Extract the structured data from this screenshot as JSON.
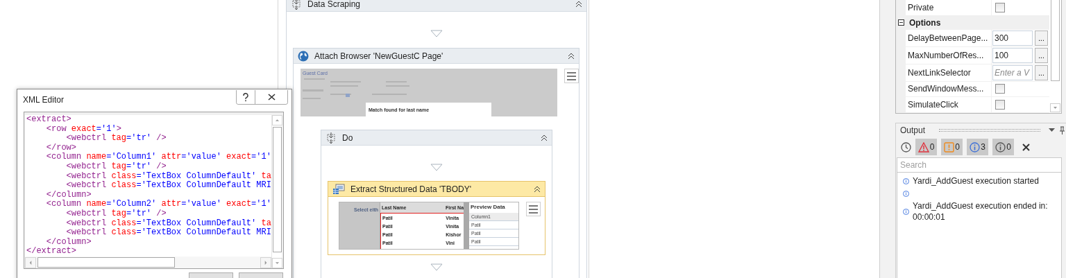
{
  "xml_editor": {
    "title": "XML Editor",
    "lines": [
      [
        {
          "kind": "tag",
          "text": "<extract>"
        }
      ],
      [
        {
          "kind": "tag",
          "text": "    <row"
        },
        {
          "kind": "attr",
          "text": " exact"
        },
        {
          "kind": "value",
          "text": "='1'"
        },
        {
          "kind": "tag",
          "text": ">"
        }
      ],
      [
        {
          "kind": "tag",
          "text": "        <webctrl"
        },
        {
          "kind": "attr",
          "text": " tag"
        },
        {
          "kind": "value",
          "text": "='tr'"
        },
        {
          "kind": "tag",
          "text": " />"
        }
      ],
      [
        {
          "kind": "tag",
          "text": "    </row>"
        }
      ],
      [
        {
          "kind": "tag",
          "text": "    <column"
        },
        {
          "kind": "attr",
          "text": " name"
        },
        {
          "kind": "value",
          "text": "='Column1'"
        },
        {
          "kind": "attr",
          "text": " attr"
        },
        {
          "kind": "value",
          "text": "='value'"
        },
        {
          "kind": "attr",
          "text": " exact"
        },
        {
          "kind": "value",
          "text": "='1'"
        }
      ],
      [
        {
          "kind": "tag",
          "text": "        <webctrl"
        },
        {
          "kind": "attr",
          "text": " tag"
        },
        {
          "kind": "value",
          "text": "='tr'"
        },
        {
          "kind": "tag",
          "text": " />"
        }
      ],
      [
        {
          "kind": "tag",
          "text": "        <webctrl"
        },
        {
          "kind": "attr",
          "text": " class"
        },
        {
          "kind": "value",
          "text": "='TextBox ColumnDefault'"
        },
        {
          "kind": "attr",
          "text": " ta"
        }
      ],
      [
        {
          "kind": "tag",
          "text": "        <webctrl"
        },
        {
          "kind": "attr",
          "text": " class"
        },
        {
          "kind": "value",
          "text": "='TextBox ColumnDefault MRI"
        }
      ],
      [
        {
          "kind": "tag",
          "text": "    </column>"
        }
      ],
      [
        {
          "kind": "tag",
          "text": "    <column"
        },
        {
          "kind": "attr",
          "text": " name"
        },
        {
          "kind": "value",
          "text": "='Column2'"
        },
        {
          "kind": "attr",
          "text": " attr"
        },
        {
          "kind": "value",
          "text": "='value'"
        },
        {
          "kind": "attr",
          "text": " exact"
        },
        {
          "kind": "value",
          "text": "='1'"
        }
      ],
      [
        {
          "kind": "tag",
          "text": "        <webctrl"
        },
        {
          "kind": "attr",
          "text": " tag"
        },
        {
          "kind": "value",
          "text": "='tr'"
        },
        {
          "kind": "tag",
          "text": " />"
        }
      ],
      [
        {
          "kind": "tag",
          "text": "        <webctrl"
        },
        {
          "kind": "attr",
          "text": " class"
        },
        {
          "kind": "value",
          "text": "='TextBox ColumnDefault'"
        },
        {
          "kind": "attr",
          "text": " ta"
        }
      ],
      [
        {
          "kind": "tag",
          "text": "        <webctrl"
        },
        {
          "kind": "attr",
          "text": " class"
        },
        {
          "kind": "value",
          "text": "='TextBox ColumnDefault MRI"
        }
      ],
      [
        {
          "kind": "tag",
          "text": "    </column>"
        }
      ],
      [
        {
          "kind": "tag",
          "text": "</extract>"
        }
      ]
    ]
  },
  "designer": {
    "sequence": {
      "title": "Data Scraping",
      "expanded": true
    },
    "attach_browser": {
      "title": "Attach Browser 'NewGuestC Page'",
      "expanded": true,
      "thumbnail": {
        "heading": "Guest Card",
        "popup_text": "Match found for last name"
      }
    },
    "do": {
      "title": "Do",
      "expanded": true
    },
    "extract": {
      "title": "Extract Structured Data 'TBODY'",
      "expanded": true,
      "selected": true,
      "preview": {
        "side_label": "Select eith",
        "columns": [
          "Last Name",
          "First Na"
        ],
        "rows": [
          [
            "Patil",
            "Vinita"
          ],
          [
            "Patil",
            "Vinita"
          ],
          [
            "Patil",
            "Kishor"
          ],
          [
            "Patil",
            "Vini"
          ]
        ],
        "panel_title": "Preview Data",
        "list_header": "Column1",
        "list": [
          "Patil",
          "Patil",
          "Patil"
        ]
      }
    }
  },
  "properties": {
    "rows": [
      {
        "kind": "checkbox",
        "name": "Private",
        "checked": false
      },
      {
        "kind": "category",
        "name": "Options",
        "expanded": true
      },
      {
        "kind": "text",
        "name": "DelayBetweenPage...",
        "value": "300",
        "button": "..."
      },
      {
        "kind": "text",
        "name": "MaxNumberOfRes...",
        "value": "100",
        "button": "..."
      },
      {
        "kind": "text",
        "name": "NextLinkSelector",
        "placeholder": "Enter a V",
        "button": "..."
      },
      {
        "kind": "checkbox",
        "name": "SendWindowMess...",
        "checked": false
      },
      {
        "kind": "checkbox",
        "name": "SimulateClick",
        "checked": false
      }
    ]
  },
  "output": {
    "title": "Output",
    "filters": [
      {
        "kind": "error",
        "count": "0",
        "selected": true
      },
      {
        "kind": "warning",
        "count": "0",
        "selected": true
      },
      {
        "kind": "info",
        "count": "3",
        "selected": true
      },
      {
        "kind": "trace",
        "count": "0",
        "selected": true
      }
    ],
    "search": {
      "placeholder": "Search"
    },
    "entries": [
      {
        "kind": "info",
        "message": "Yardi_AddGuest execution started"
      },
      {
        "kind": "info"
      },
      {
        "kind": "info",
        "message": "Yardi_AddGuest execution ended in: 00:00:01"
      }
    ]
  }
}
